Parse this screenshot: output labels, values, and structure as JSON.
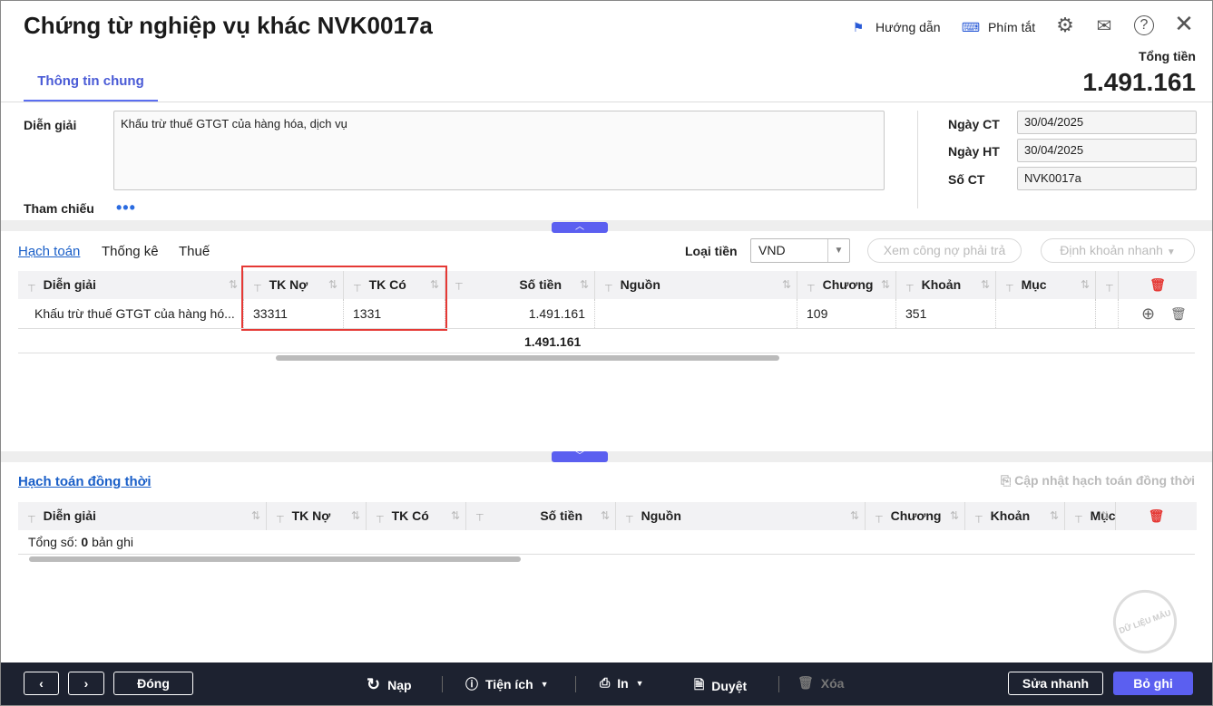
{
  "header": {
    "title": "Chứng từ nghiệp vụ khác NVK0017a",
    "guide": "Hướng dẫn",
    "shortcuts": "Phím tắt",
    "total_label": "Tổng tiền",
    "total_value": "1.491.161"
  },
  "tabs": [
    {
      "label": "Thông tin chung"
    }
  ],
  "form": {
    "description_label": "Diễn giải",
    "description_value": "Khấu trừ thuế GTGT của hàng hóa, dịch vụ",
    "reference_label": "Tham chiếu",
    "date_ct_label": "Ngày CT",
    "date_ct": "30/04/2025",
    "date_ht_label": "Ngày HT",
    "date_ht": "30/04/2025",
    "so_ct_label": "Số CT",
    "so_ct": "NVK0017a"
  },
  "detail": {
    "tabs": [
      "Hạch toán",
      "Thống kê",
      "Thuế"
    ],
    "currency_label": "Loại tiền",
    "currency": "VND",
    "view_debt": "Xem công nợ phải trả",
    "quick_entry": "Định khoản nhanh",
    "columns": [
      "Diễn giải",
      "TK Nợ",
      "TK Có",
      "Số tiền",
      "Nguồn",
      "Chương",
      "Khoản",
      "Mục",
      ""
    ],
    "rows": [
      [
        "Khấu trừ thuế GTGT của hàng hó...",
        "33311",
        "1331",
        "1.491.161",
        "",
        "109",
        "351",
        "",
        ""
      ]
    ],
    "total": "1.491.161"
  },
  "simul": {
    "title": "Hạch toán đồng thời",
    "update": "Cập nhật hạch toán đồng thời",
    "columns": [
      "Diễn giải",
      "TK Nợ",
      "TK Có",
      "Số tiền",
      "Nguồn",
      "Chương",
      "Khoản",
      "Mục"
    ],
    "count_prefix": "Tổng số:",
    "count": "0",
    "count_suffix": "bản ghi"
  },
  "watermark": "DỮ LIỆU MẪU",
  "footer": {
    "close": "Đóng",
    "reload": "Nạp",
    "utilities": "Tiện ích",
    "print": "In",
    "approve": "Duyệt",
    "delete": "Xóa",
    "quick_edit": "Sửa nhanh",
    "save": "Bỏ ghi"
  },
  "colors": {
    "accent": "#5b5ff0",
    "highlight": "#e53935",
    "footer": "#1d2230"
  }
}
